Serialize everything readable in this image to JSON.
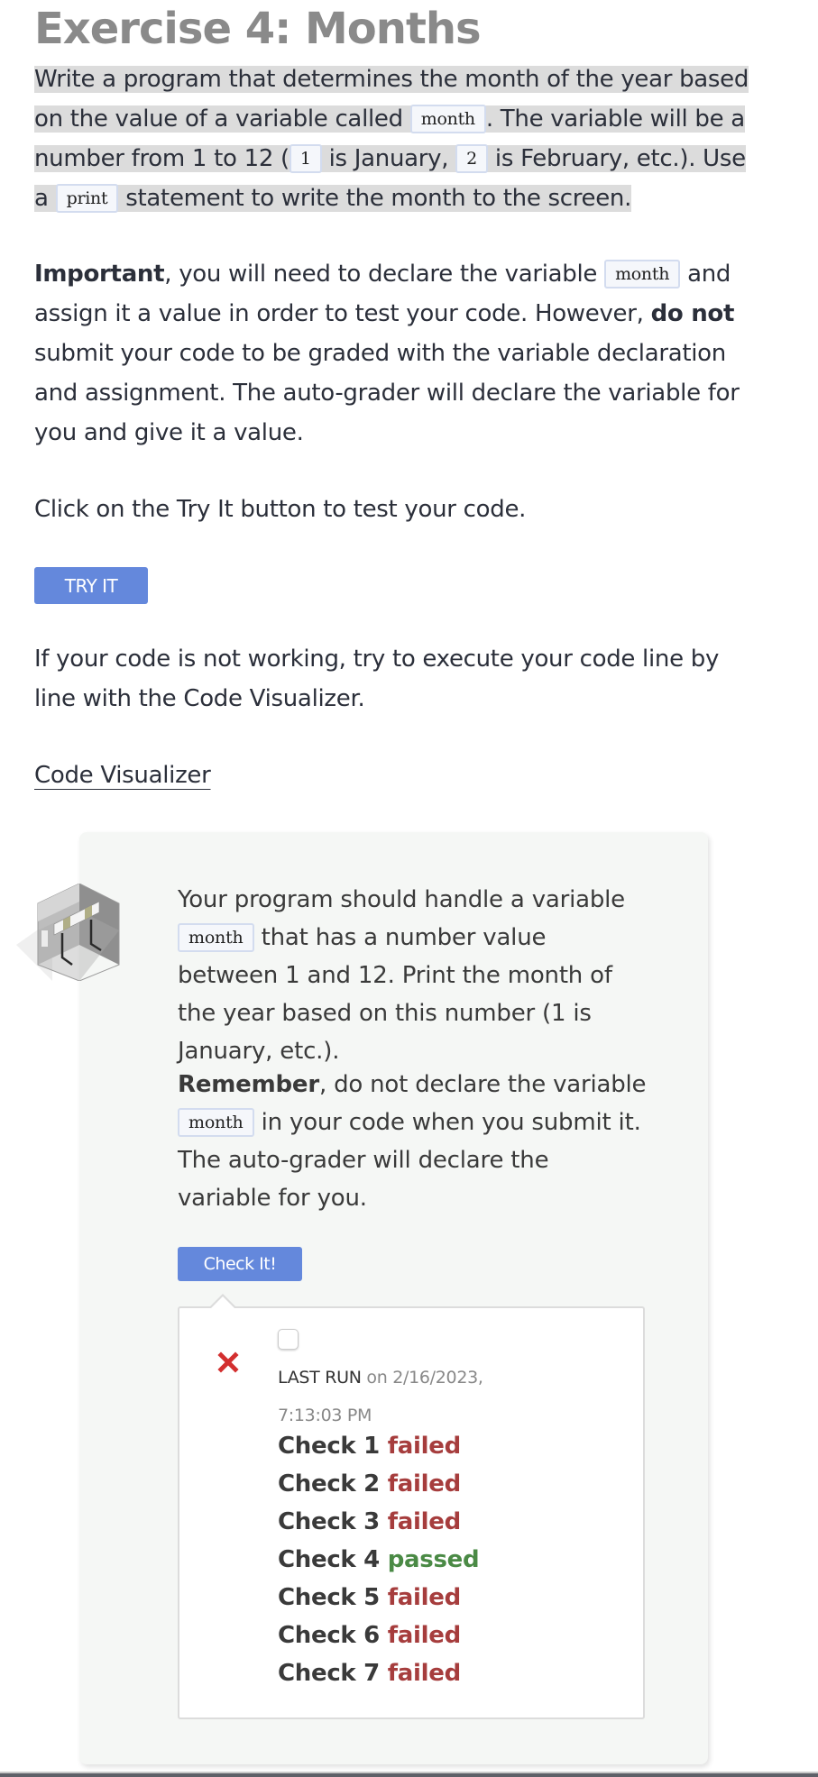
{
  "page": {
    "title": "Exercise 4: Months",
    "intro": {
      "t1": "Write a program that determines the month of the year based on the value of a variable called ",
      "code1": "month",
      "t2": ". The variable will be a number from 1 to 12 (",
      "code2": "1",
      "t3": " is January, ",
      "code3": "2",
      "t4": " is February, etc.). Use a ",
      "code4": "print",
      "t5": " statement to write the month to the screen."
    },
    "important": {
      "bold1": "Important",
      "t1": ", you will need to declare the variable ",
      "code1": "month",
      "t2": " and assign it a value in order to test your code. However, ",
      "bold2": "do not",
      "t3": " submit your code to be graded with the variable declaration and assignment. The auto-grader will declare the variable for you and give it a value."
    },
    "try_instructions": "Click on the Try It button to test your code.",
    "try_button": "TRY IT",
    "visualizer_text": "If your code is not working, try to execute your code line by line with the Code Visualizer.",
    "visualizer_link": "Code Visualizer"
  },
  "guide": {
    "p1": {
      "t1": "Your program should handle a variable ",
      "code1": "month",
      "t2": " that has a number value between 1 and 12. Print the month of the year based on this number (1 is January, etc.)."
    },
    "p2": {
      "bold1": "Remember",
      "t1": ", do not declare the variable ",
      "code1": "month",
      "t2": " in your code when you submit it. The auto-grader will declare the variable for you."
    },
    "check_button": "Check It!",
    "result": {
      "status_icon": "x-mark-icon",
      "last_run_label": "LAST RUN",
      "last_run_time": " on 2/16/2023, 7:13:03 PM",
      "checks": [
        {
          "label": "Check 1",
          "status": "failed"
        },
        {
          "label": "Check 2",
          "status": "failed"
        },
        {
          "label": "Check 3",
          "status": "failed"
        },
        {
          "label": "Check 4",
          "status": "passed"
        },
        {
          "label": "Check 5",
          "status": "failed"
        },
        {
          "label": "Check 6",
          "status": "failed"
        },
        {
          "label": "Check 7",
          "status": "failed"
        }
      ]
    }
  },
  "colors": {
    "accent": "#6488dc",
    "failed": "#a63d3d",
    "passed": "#4a8a45",
    "error_icon": "#d32f2f"
  }
}
